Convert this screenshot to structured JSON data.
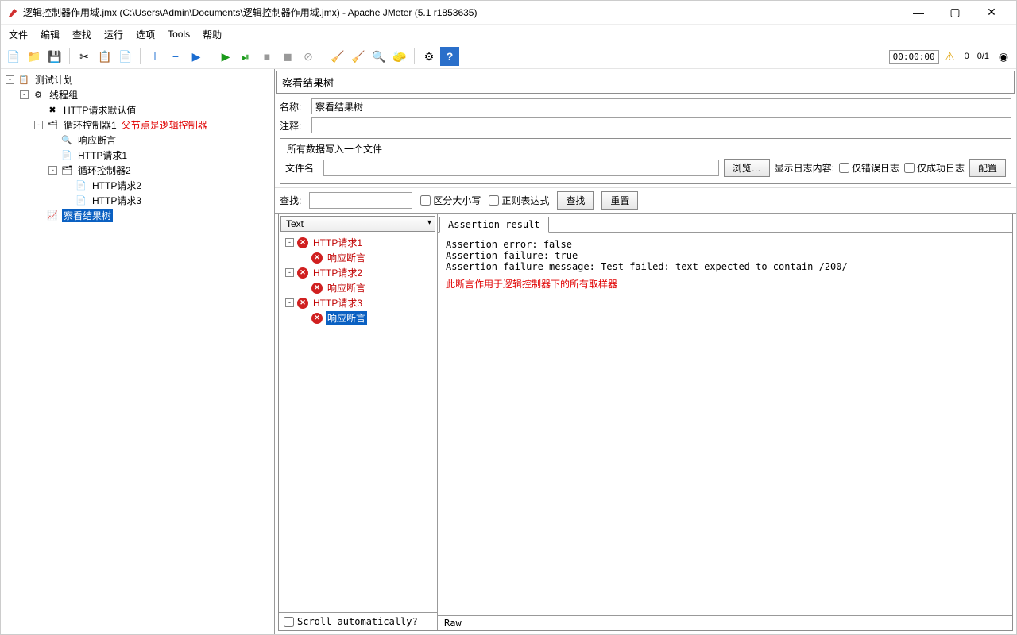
{
  "window": {
    "title": "逻辑控制器作用域.jmx (C:\\Users\\Admin\\Documents\\逻辑控制器作用域.jmx) - Apache JMeter (5.1 r1853635)",
    "minimize": "—",
    "maximize": "▢",
    "close": "✕"
  },
  "menubar": {
    "items": [
      "文件",
      "编辑",
      "查找",
      "运行",
      "选项",
      "Tools",
      "帮助"
    ]
  },
  "toolbar": {
    "timer": "00:00:00",
    "warn_icon": "⚠",
    "warn_count": "0",
    "thread_status": "0/1"
  },
  "tree": [
    {
      "indent": 0,
      "toggle": "-",
      "icon": "📋",
      "label": "测试计划",
      "selected": false
    },
    {
      "indent": 1,
      "toggle": "-",
      "icon": "⚙",
      "label": "线程组",
      "selected": false
    },
    {
      "indent": 2,
      "toggle": "",
      "icon": "✖",
      "label": "HTTP请求默认值",
      "selected": false
    },
    {
      "indent": 2,
      "toggle": "-",
      "icon": "🗂",
      "label": "循环控制器1",
      "selected": false,
      "anno": "父节点是逻辑控制器"
    },
    {
      "indent": 3,
      "toggle": "",
      "icon": "🔍",
      "label": "响应断言",
      "selected": false
    },
    {
      "indent": 3,
      "toggle": "",
      "icon": "📄",
      "label": "HTTP请求1",
      "selected": false
    },
    {
      "indent": 3,
      "toggle": "-",
      "icon": "🗂",
      "label": "循环控制器2",
      "selected": false
    },
    {
      "indent": 4,
      "toggle": "",
      "icon": "📄",
      "label": "HTTP请求2",
      "selected": false
    },
    {
      "indent": 4,
      "toggle": "",
      "icon": "📄",
      "label": "HTTP请求3",
      "selected": false
    },
    {
      "indent": 2,
      "toggle": "",
      "icon": "📈",
      "label": "察看结果树",
      "selected": true
    }
  ],
  "panel": {
    "title": "察看结果树",
    "name_label": "名称:",
    "name_value": "察看结果树",
    "comment_label": "注释:",
    "comment_value": "",
    "file_group_legend": "所有数据写入一个文件",
    "file_label": "文件名",
    "file_value": "",
    "browse_btn": "浏览…",
    "logshow_label": "显示日志内容:",
    "chk_err_only": "仅错误日志",
    "chk_suc_only": "仅成功日志",
    "config_btn": "配置"
  },
  "search": {
    "label": "查找:",
    "value": "",
    "chk_case": "区分大小写",
    "chk_regex": "正则表达式",
    "find_btn": "查找",
    "reset_btn": "重置"
  },
  "results": {
    "dropdown": "Text",
    "scroll_label": "Scroll automatically?",
    "nodes": [
      {
        "indent": 0,
        "toggle": "-",
        "label": "HTTP请求1",
        "selected": false
      },
      {
        "indent": 1,
        "toggle": "",
        "label": "响应断言",
        "selected": false
      },
      {
        "indent": 0,
        "toggle": "-",
        "label": "HTTP请求2",
        "selected": false
      },
      {
        "indent": 1,
        "toggle": "",
        "label": "响应断言",
        "selected": false
      },
      {
        "indent": 0,
        "toggle": "-",
        "label": "HTTP请求3",
        "selected": false
      },
      {
        "indent": 1,
        "toggle": "",
        "label": "响应断言",
        "selected": true
      }
    ]
  },
  "assertion": {
    "tab": "Assertion result",
    "lines": [
      "Assertion error: false",
      "Assertion failure: true",
      "Assertion failure message: Test failed: text expected to contain /200/"
    ],
    "annotation": "此断言作用于逻辑控制器下的所有取样器",
    "raw_tab": "Raw"
  }
}
